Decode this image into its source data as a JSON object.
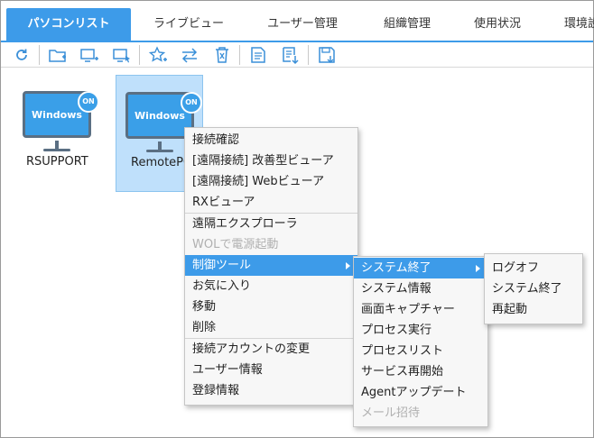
{
  "tabs": [
    {
      "label": "パソコンリスト",
      "active": true
    },
    {
      "label": "ライブビュー",
      "active": false
    },
    {
      "label": "ユーザー管理",
      "active": false
    },
    {
      "label": "組織管理",
      "active": false
    },
    {
      "label": "使用状況",
      "active": false
    },
    {
      "label": "環境設",
      "active": false
    }
  ],
  "toolbar": {
    "icons": [
      "refresh-icon",
      "add-folder-icon",
      "add-computer-icon",
      "select-computer-icon",
      "favorite-add-icon",
      "move-icon",
      "delete-icon",
      "report-icon",
      "export-icon",
      "save-icon"
    ]
  },
  "devices": [
    {
      "name": "RSUPPORT",
      "os_label": "Windows",
      "status": "ON"
    },
    {
      "name": "RemotePC",
      "os_label": "Windows",
      "status": "ON"
    }
  ],
  "context_menu": {
    "groups": [
      [
        {
          "label": "接続確認",
          "disabled": false
        },
        {
          "label": "[遠隔接続] 改善型ビューア",
          "disabled": false
        },
        {
          "label": "[遠隔接続] Webビューア",
          "disabled": false
        },
        {
          "label": "RXビューア",
          "disabled": false
        }
      ],
      [
        {
          "label": "遠隔エクスプローラ",
          "disabled": false
        },
        {
          "label": "WOLで電源起動",
          "disabled": true
        },
        {
          "label": "制御ツール",
          "disabled": false,
          "submenu": true
        },
        {
          "label": "お気に入り",
          "disabled": false
        },
        {
          "label": "移動",
          "disabled": false
        },
        {
          "label": "削除",
          "disabled": false
        }
      ],
      [
        {
          "label": "接続アカウントの変更",
          "disabled": false
        },
        {
          "label": "ユーザー情報",
          "disabled": false
        },
        {
          "label": "登録情報",
          "disabled": false
        }
      ]
    ]
  },
  "control_tools_menu": {
    "items": [
      {
        "label": "システム終了",
        "disabled": false,
        "submenu": true
      },
      {
        "label": "システム情報",
        "disabled": false
      },
      {
        "label": "画面キャプチャー",
        "disabled": false
      },
      {
        "label": "プロセス実行",
        "disabled": false
      },
      {
        "label": "プロセスリスト",
        "disabled": false
      },
      {
        "label": "サービス再開始",
        "disabled": false
      },
      {
        "label": "Agentアップデート",
        "disabled": false
      },
      {
        "label": "メール招待",
        "disabled": true
      }
    ]
  },
  "shutdown_menu": {
    "items": [
      {
        "label": "ログオフ"
      },
      {
        "label": "システム終了"
      },
      {
        "label": "再起動"
      }
    ]
  },
  "colors": {
    "accent": "#3d9be9",
    "monitor": "#3a9fe8",
    "selected_bg": "#bfe0fb"
  }
}
